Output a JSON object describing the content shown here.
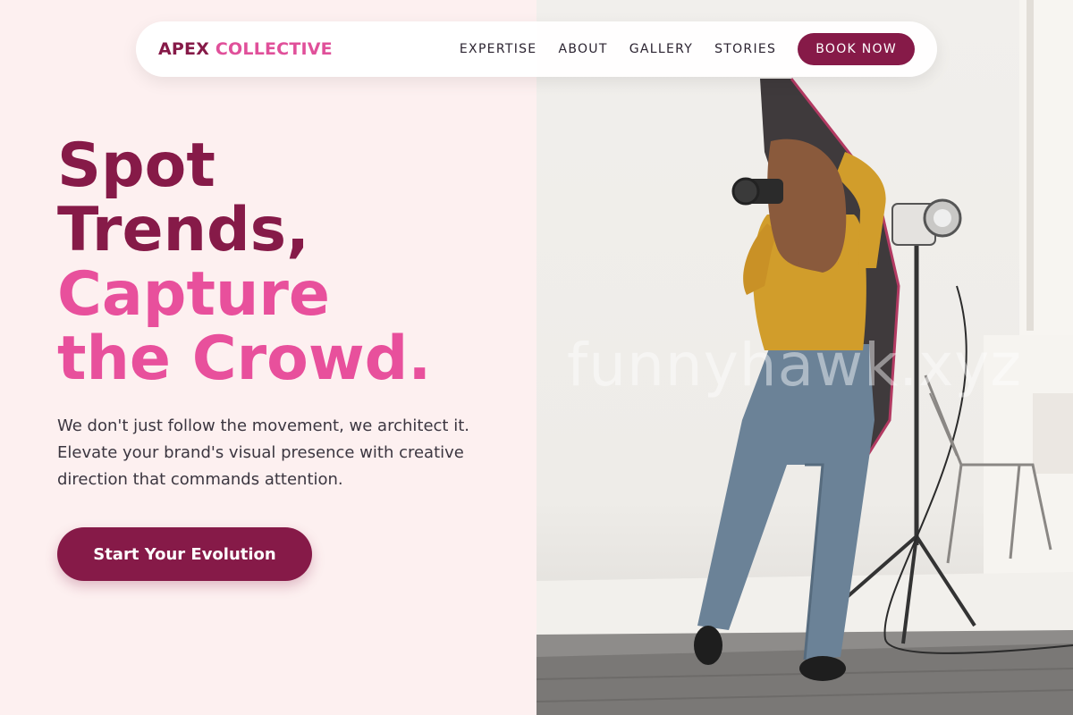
{
  "brand": {
    "part1": "APEX",
    "part2": "COLLECTIVE"
  },
  "nav": {
    "items": [
      {
        "label": "EXPERTISE"
      },
      {
        "label": "ABOUT"
      },
      {
        "label": "GALLERY"
      },
      {
        "label": "STORIES"
      }
    ],
    "cta_label": "BOOK NOW"
  },
  "hero": {
    "headline_lines": [
      {
        "text": "Spot",
        "tone": "dark"
      },
      {
        "text": "Trends,",
        "tone": "dark"
      },
      {
        "text": "Capture",
        "tone": "pink"
      },
      {
        "text": "the Crowd.",
        "tone": "pink"
      }
    ],
    "subtext": "We don't just follow the movement, we architect it. Elevate your brand's visual presence with creative direction that commands attention.",
    "cta_label": "Start Your Evolution"
  },
  "photo": {
    "watermark": "funnyhawk.xyz",
    "alt": "Photographer in a mustard sweater shooting with a camera in a bright studio with softbox lighting"
  },
  "colors": {
    "brand_dark": "#861a48",
    "brand_pink": "#e8509c",
    "background": "#fdf0f0",
    "text": "#3b3640"
  }
}
